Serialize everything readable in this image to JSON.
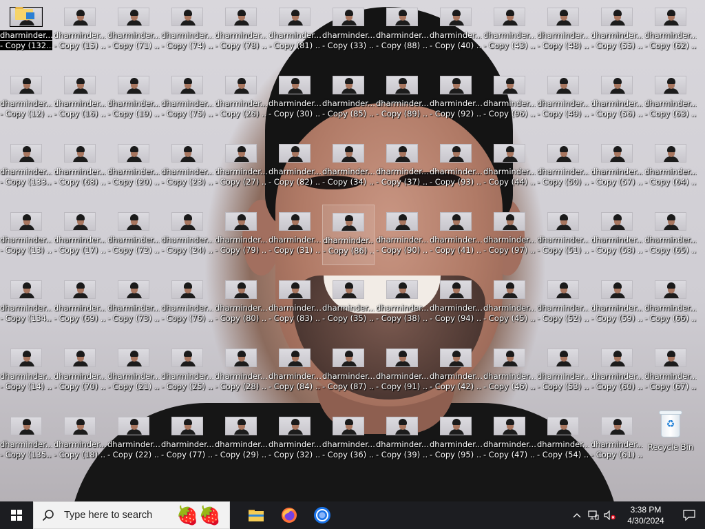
{
  "desktop": {
    "columns": [
      [
        "dharminder... - Copy (132...",
        "dharminder... - Copy (12) ...",
        "dharminder... - Copy (133...",
        "dharminder... - Copy (13) ...",
        "dharminder... - Copy (134...",
        "dharminder... - Copy (14) ...",
        "dharminder... - Copy (135..."
      ],
      [
        "dharminder... - Copy (15) ...",
        "dharminder... - Copy (16) ...",
        "dharminder... - Copy (68) ...",
        "dharminder... - Copy (17) ...",
        "dharminder... - Copy (69) ...",
        "dharminder... - Copy (70) ...",
        "dharminder... - Copy (18) ..."
      ],
      [
        "dharminder... - Copy (71) ...",
        "dharminder... - Copy (19) ...",
        "dharminder... - Copy (20) ...",
        "dharminder... - Copy (72) ...",
        "dharminder... - Copy (73) ...",
        "dharminder... - Copy (21) ...",
        "dharminder... - Copy (22) ..."
      ],
      [
        "dharminder... - Copy (74) ...",
        "dharminder... - Copy (75) ...",
        "dharminder... - Copy (23) ...",
        "dharminder... - Copy (24) ...",
        "dharminder... - Copy (76) ...",
        "dharminder... - Copy (25) ...",
        "dharminder... - Copy (77) ..."
      ],
      [
        "dharminder... - Copy (78) ...",
        "dharminder... - Copy (26) ...",
        "dharminder... - Copy (27) ...",
        "dharminder... - Copy (79) ...",
        "dharminder... - Copy (80) ...",
        "dharminder... - Copy (28) ...",
        "dharminder... - Copy (29) ..."
      ],
      [
        "dharminder... - Copy (81) ...",
        "dharminder... - Copy (30) ...",
        "dharminder... - Copy (82) ...",
        "dharminder... - Copy (31) ...",
        "dharminder... - Copy (83) ...",
        "dharminder... - Copy (84) ...",
        "dharminder... - Copy (32) ..."
      ],
      [
        "dharminder... - Copy (33) ...",
        "dharminder... - Copy (85) ...",
        "dharminder... - Copy (34) ...",
        "dharminder... - Copy (86) ...",
        "dharminder... - Copy (35) ...",
        "dharminder... - Copy (87) ...",
        "dharminder... - Copy (36) ..."
      ],
      [
        "dharminder... - Copy (88) ...",
        "dharminder... - Copy (89) ...",
        "dharminder... - Copy (37) ...",
        "dharminder... - Copy (90) ...",
        "dharminder... - Copy (38) ...",
        "dharminder... - Copy (91) ...",
        "dharminder... - Copy (39) ..."
      ],
      [
        "dharminder... - Copy (40) ...",
        "dharminder... - Copy (92) ...",
        "dharminder... - Copy (93) ...",
        "dharminder... - Copy (41) ...",
        "dharminder... - Copy (94) ...",
        "dharminder... - Copy (42) ...",
        "dharminder... - Copy (95) ..."
      ],
      [
        "dharminder... - Copy (43) ...",
        "dharminder... - Copy (96) ...",
        "dharminder... - Copy (44) ...",
        "dharminder... - Copy (97) ...",
        "dharminder... - Copy (45) ...",
        "dharminder... - Copy (46) ...",
        "dharminder... - Copy (47) ..."
      ],
      [
        "dharminder... - Copy (48) ...",
        "dharminder... - Copy (49) ...",
        "dharminder... - Copy (50) ...",
        "dharminder... - Copy (51) ...",
        "dharminder... - Copy (52) ...",
        "dharminder... - Copy (53) ...",
        "dharminder... - Copy (54) ..."
      ],
      [
        "dharminder... - Copy (55) ...",
        "dharminder... - Copy (56) ...",
        "dharminder... - Copy (57) ...",
        "dharminder... - Copy (58) ...",
        "dharminder... - Copy (59) ...",
        "dharminder... - Copy (60) ...",
        "dharminder... - Copy (61) ..."
      ],
      [
        "dharminder... - Copy (62) ...",
        "dharminder... - Copy (63) ...",
        "dharminder... - Copy (64) ...",
        "dharminder... - Copy (65) ...",
        "dharminder... - Copy (66) ...",
        "dharminder... - Copy (67) ...",
        "Recycle Bin"
      ]
    ],
    "selected_icon": "dharminder... - Copy (132...",
    "hovered_icon": "dharminder... - Copy (86) ..."
  },
  "taskbar": {
    "search_placeholder": "Type here to search",
    "apps": [
      "file-explorer",
      "firefox",
      "chrome"
    ],
    "clock_time": "3:38 PM",
    "clock_date": "4/30/2024"
  },
  "colors": {
    "taskbar_bg": "#1c1d21",
    "search_bg": "#f2f2f2"
  }
}
